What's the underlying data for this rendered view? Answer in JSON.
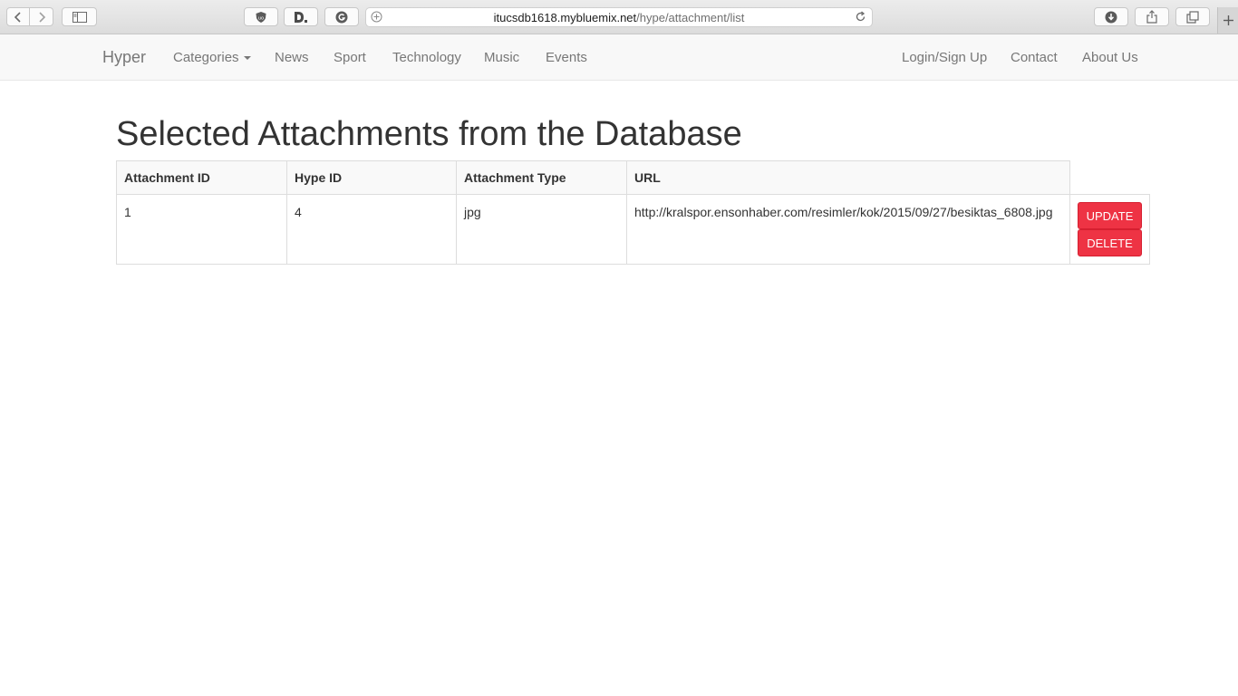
{
  "browser": {
    "url_host": "itucsdb1618.mybluemix.net",
    "url_path": "/hype/attachment/list"
  },
  "navbar": {
    "brand": "Hyper",
    "left_items": [
      "Categories",
      "News",
      "Sport",
      "Technology",
      "Music",
      "Events"
    ],
    "right_items": [
      "Login/Sign Up",
      "Contact",
      "About Us"
    ]
  },
  "page": {
    "title": "Selected Attachments from the Database"
  },
  "table": {
    "headers": [
      "Attachment ID",
      "Hype ID",
      "Attachment Type",
      "URL"
    ],
    "rows": [
      {
        "attachment_id": "1",
        "hype_id": "4",
        "attachment_type": "jpg",
        "url": "http://kralspor.ensonhaber.com/resimler/kok/2015/09/27/besiktas_6808.jpg",
        "update_label": "UPDATE",
        "delete_label": "DELETE"
      }
    ]
  },
  "colors": {
    "button_red": "#ee3344",
    "navbar_bg": "#f8f8f8"
  }
}
